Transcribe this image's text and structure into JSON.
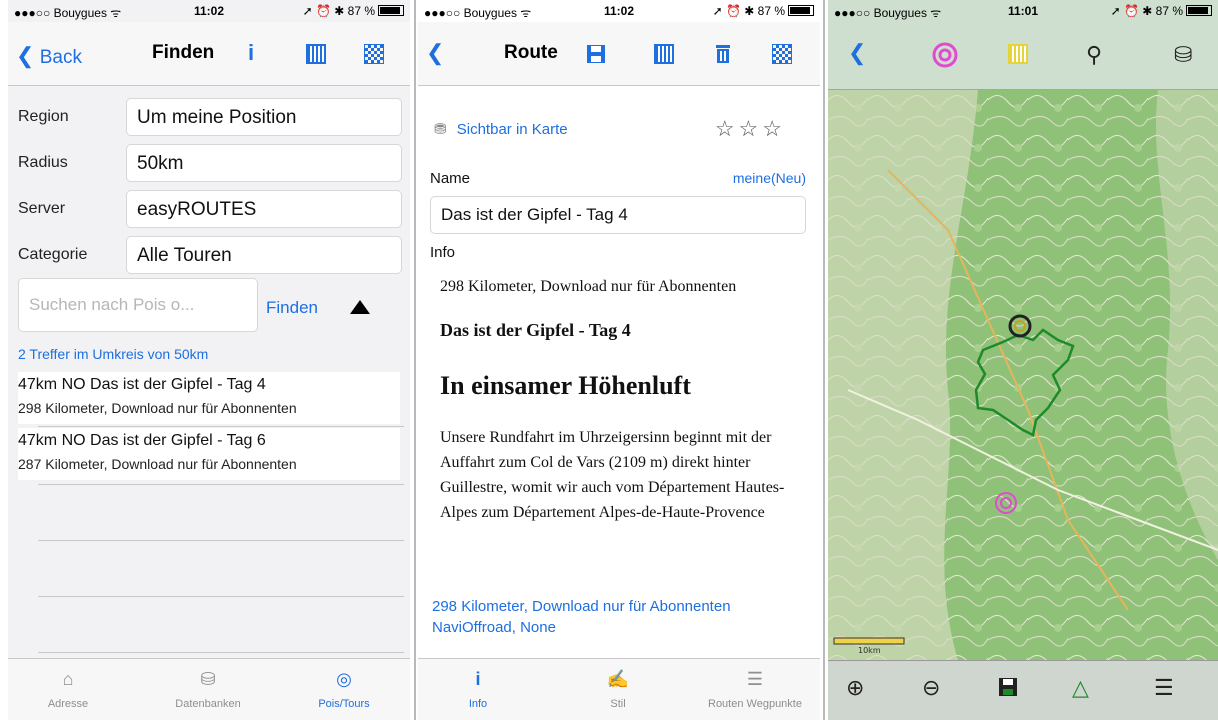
{
  "status": {
    "carrier": "●●●○○ Bouygues ᯤ",
    "time1": "11:02",
    "time2": "11:02",
    "time3": "11:01",
    "right": "➚ ⏰ ✱ 87 %"
  },
  "p1": {
    "back_label": "Back",
    "title": "Finden",
    "fields": [
      {
        "label": "Region",
        "value": "Um meine Position"
      },
      {
        "label": "Radius",
        "value": "50km"
      },
      {
        "label": "Server",
        "value": "easyROUTES"
      },
      {
        "label": "Categorie",
        "value": "Alle Touren"
      }
    ],
    "search_placeholder": "Suchen nach Pois o...",
    "find_label": "Finden",
    "hits": "2 Treffer im Umkreis von 50km",
    "results": [
      {
        "line1": "47km NO  Das ist der Gipfel - Tag 4",
        "line2": "298 Kilometer, Download nur für Abonnenten"
      },
      {
        "line1": "47km NO  Das ist der Gipfel - Tag 6",
        "line2": "287 Kilometer, Download nur für Abonnenten"
      }
    ],
    "tabs": [
      "Adresse",
      "Datenbanken",
      "Pois/Tours"
    ]
  },
  "p2": {
    "title": "Route",
    "visible_label": "Sichtbar in Karte",
    "name_label": "Name",
    "name_link": "meine(Neu)",
    "name_value": "Das ist der Gipfel - Tag 4",
    "info_label": "Info",
    "info_p1": "298 Kilometer, Download nur für Abonnenten",
    "info_h3": "Das ist der Gipfel - Tag 4",
    "info_h1": "In einsamer Höhenluft",
    "info_body": "Unsere Rundfahrt im Uhrzeigersinn beginnt mit der Auffahrt zum Col de Vars (2109 m) direkt hinter Guillestre, womit wir auch vom Département Hautes-Alpes zum Département Alpes-de-Haute-Provence",
    "footer1": "298 Kilometer, Download nur für Abonnenten",
    "footer2": "NaviOffroad, None",
    "tabs": [
      "Info",
      "Stil",
      "Routen Wegpunkte"
    ]
  },
  "p3": {
    "scale": "10km"
  },
  "colors": {
    "accent": "#1e6fe0",
    "route": "#1f8a2a",
    "target": "#e04bd0"
  }
}
